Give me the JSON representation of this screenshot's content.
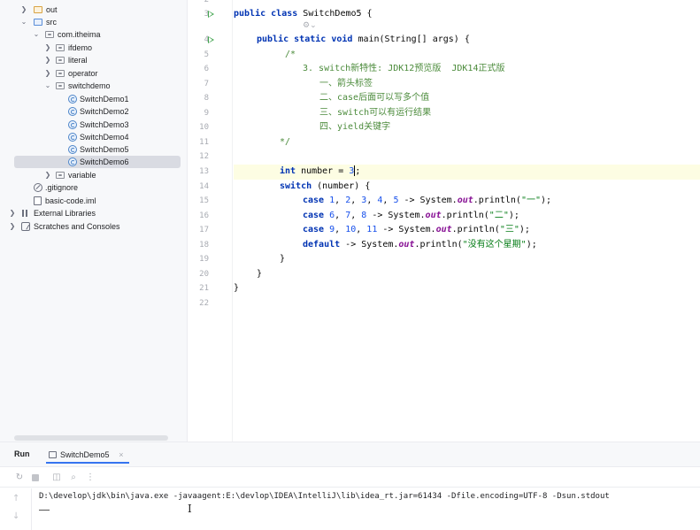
{
  "project_tree": [
    {
      "label": "out",
      "icon": "folder-icon",
      "kind": "out-folder",
      "expanded": false
    },
    {
      "label": "src",
      "icon": "folder-icon",
      "kind": "src-folder",
      "expanded": true
    },
    {
      "label": "com.itheima",
      "icon": "package-icon",
      "kind": "package",
      "expanded": true
    },
    {
      "label": "ifdemo",
      "icon": "package-icon",
      "kind": "package",
      "expanded": false
    },
    {
      "label": "literal",
      "icon": "package-icon",
      "kind": "package",
      "expanded": false
    },
    {
      "label": "operator",
      "icon": "package-icon",
      "kind": "package",
      "expanded": false
    },
    {
      "label": "switchdemo",
      "icon": "package-icon",
      "kind": "package",
      "expanded": true
    },
    {
      "label": "SwitchDemo1",
      "icon": "class-icon",
      "kind": "class"
    },
    {
      "label": "SwitchDemo2",
      "icon": "class-icon",
      "kind": "class"
    },
    {
      "label": "SwitchDemo3",
      "icon": "class-icon",
      "kind": "class"
    },
    {
      "label": "SwitchDemo4",
      "icon": "class-icon",
      "kind": "class"
    },
    {
      "label": "SwitchDemo5",
      "icon": "class-icon",
      "kind": "class"
    },
    {
      "label": "SwitchDemo6",
      "icon": "class-icon",
      "kind": "class",
      "selected": true
    },
    {
      "label": "variable",
      "icon": "package-icon",
      "kind": "package",
      "expanded": false
    },
    {
      "label": ".gitignore",
      "icon": "gitignore-icon",
      "kind": "file"
    },
    {
      "label": "basic-code.iml",
      "icon": "file-icon",
      "kind": "file"
    },
    {
      "label": "External Libraries",
      "icon": "library-icon",
      "kind": "lib",
      "expanded": false
    },
    {
      "label": "Scratches and Consoles",
      "icon": "scratch-icon",
      "kind": "scratch",
      "expanded": false
    }
  ],
  "editor": {
    "line_numbers": [
      "2",
      "3",
      "4",
      "5",
      "6",
      "7",
      "8",
      "9",
      "10",
      "11",
      "12",
      "13",
      "14",
      "15",
      "16",
      "17",
      "18",
      "19",
      "20",
      "21",
      "22"
    ],
    "current_line": "13",
    "code": {
      "l3_kw1": "public",
      "l3_kw2": "class",
      "l3_name": "SwitchDemo5 {",
      "l4_kw1": "public",
      "l4_kw2": "static",
      "l4_kw3": "void",
      "l4_rest": "main(String[] args) {",
      "l5": "/*",
      "l6": "3. switch新特性: JDK12预览版  JDK14正式版",
      "l7": "一、箭头标签",
      "l8": "二、case后面可以写多个值",
      "l9": "三、switch可以有运行结果",
      "l10": "四、yield关键字",
      "l11": "*/",
      "l13_kw": "int",
      "l13_a": " number = ",
      "l13_num": "3",
      "l13_b": ";",
      "l14_kw": "switch",
      "l14_rest": " (number) {",
      "case_kw": "case",
      "default_kw": "default",
      "arrow_sys": " -> System.",
      "out": "out",
      "println": ".println(",
      "end": ");",
      "l15_n1": "1",
      "l15_n2": "2",
      "l15_n3": "3",
      "l15_n4": "4",
      "l15_n5": "5",
      "l15_str": "\"一\"",
      "l16_n1": "6",
      "l16_n2": "7",
      "l16_n3": "8",
      "l16_str": "\"二\"",
      "l17_n1": "9",
      "l17_n2": "10",
      "l17_n3": "11",
      "l17_str": "\"三\"",
      "l18_str": "\"没有这个星期\"",
      "comma": ", ",
      "close": "}"
    }
  },
  "run_panel": {
    "title": "Run",
    "tab_label": "SwitchDemo5",
    "tab_close": "×",
    "command_line": "D:\\develop\\jdk\\bin\\java.exe -javaagent:E:\\devlop\\IDEA\\IntelliJ\\lib\\idea_rt.jar=61434 -Dfile.encoding=UTF-8 -Dsun.stdout",
    "toolbar": [
      "rerun-icon",
      "stop-icon",
      "camera-icon",
      "search-icon",
      "more-icon"
    ]
  },
  "colors": {
    "keyword": "#0033b3",
    "comment": "#4b8b3b",
    "string": "#067d17",
    "number": "#1750eb",
    "static_field": "#871094",
    "run_gutter": "#3fa34d",
    "selection": "#d9dbe2",
    "accent": "#3574f0"
  }
}
